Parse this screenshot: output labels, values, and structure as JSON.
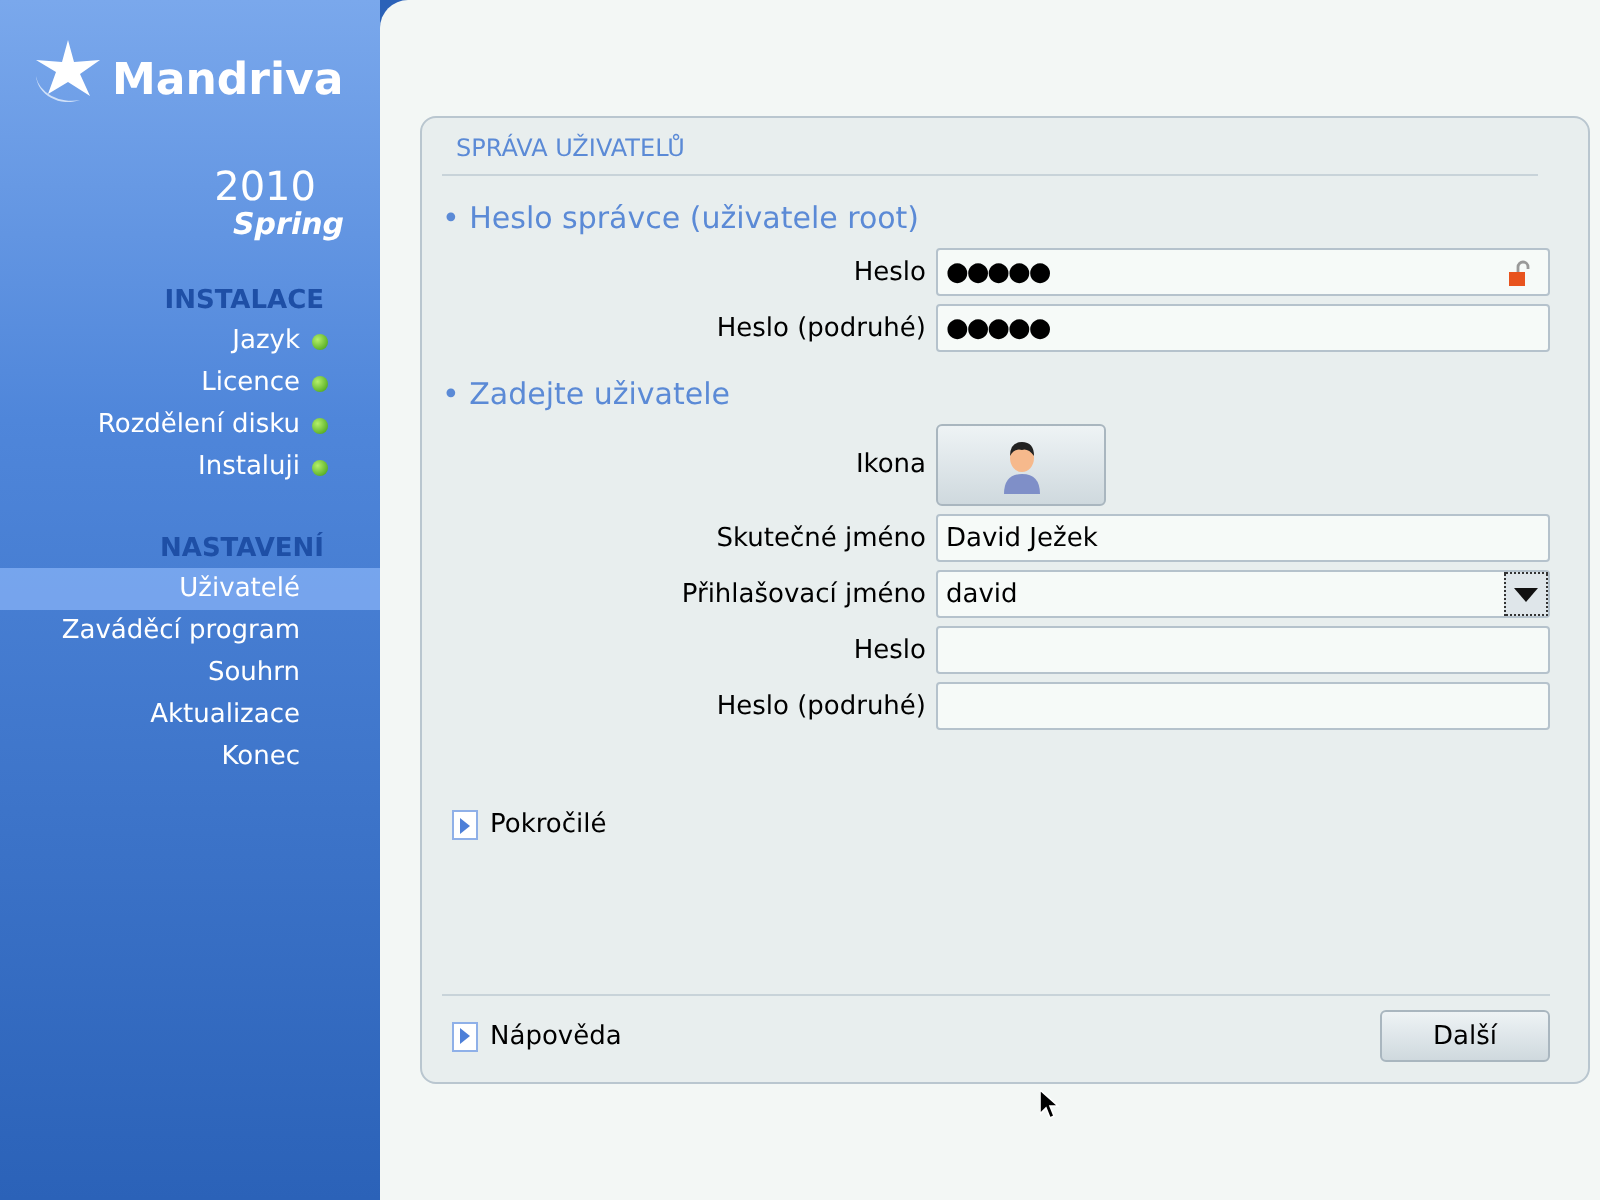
{
  "sidebar": {
    "logo": "Mandriva",
    "version": "2010",
    "edition": "Spring",
    "sections": [
      {
        "title": "INSTALACE",
        "items": [
          {
            "label": "Jazyk",
            "done": true,
            "selected": false
          },
          {
            "label": "Licence",
            "done": true,
            "selected": false
          },
          {
            "label": "Rozdělení disku",
            "done": true,
            "selected": false
          },
          {
            "label": "Instaluji",
            "done": true,
            "selected": false
          }
        ]
      },
      {
        "title": "NASTAVENÍ",
        "items": [
          {
            "label": "Uživatelé",
            "done": false,
            "selected": true
          },
          {
            "label": "Zaváděcí program",
            "done": false,
            "selected": false
          },
          {
            "label": "Souhrn",
            "done": false,
            "selected": false
          },
          {
            "label": "Aktualizace",
            "done": false,
            "selected": false
          },
          {
            "label": "Konec",
            "done": false,
            "selected": false
          }
        ]
      }
    ]
  },
  "panel": {
    "title": "SPRÁVA UŽIVATELŮ",
    "groups": [
      {
        "title": "• Heslo správce (uživatele root)",
        "fields": [
          {
            "kind": "password",
            "label": "Heslo",
            "value": "●●●●●",
            "lock": true
          },
          {
            "kind": "password",
            "label": "Heslo (podruhé)",
            "value": "●●●●●",
            "lock": false
          }
        ]
      },
      {
        "title": "• Zadejte uživatele",
        "fields": [
          {
            "kind": "icon",
            "label": "Ikona"
          },
          {
            "kind": "text",
            "label": "Skutečné jméno",
            "value": "David Ježek"
          },
          {
            "kind": "combo",
            "label": "Přihlašovací jméno",
            "value": "david"
          },
          {
            "kind": "password",
            "label": "Heslo",
            "lock": false
          },
          {
            "kind": "password",
            "label": "Heslo (podruhé)",
            "lock": false
          }
        ]
      }
    ],
    "advanced": {
      "label": "Pokročilé",
      "expanded": false
    },
    "help": {
      "label": "Nápověda",
      "expanded": false
    },
    "next_button": "Další"
  }
}
